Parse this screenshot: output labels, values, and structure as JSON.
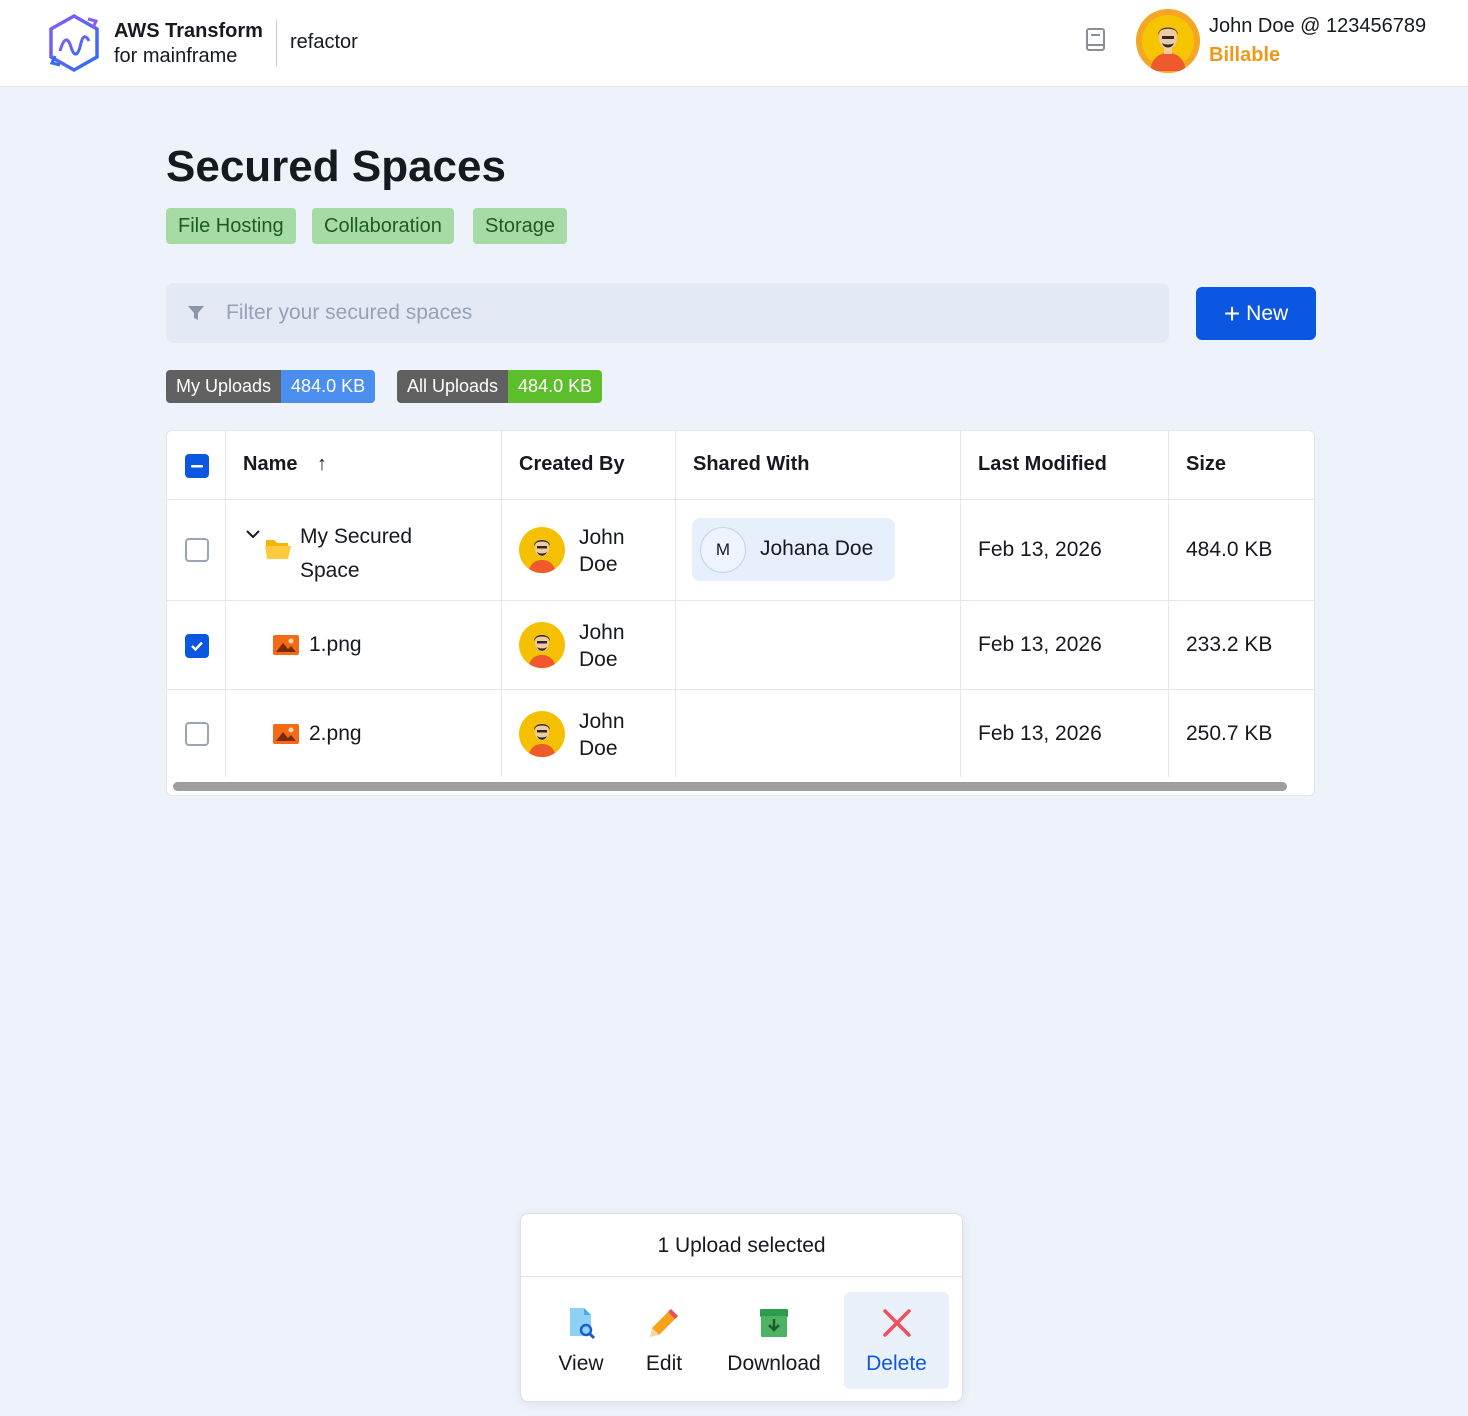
{
  "header": {
    "brand_line1": "AWS Transform",
    "brand_line2": "for mainframe",
    "brand_sub": "refactor",
    "user_name": "John Doe @ 123456789",
    "user_status": "Billable",
    "accent_color": "#ec9a1a"
  },
  "page": {
    "title": "Secured Spaces",
    "tags": [
      "File Hosting",
      "Collaboration",
      "Storage"
    ]
  },
  "filter": {
    "placeholder": "Filter your secured spaces",
    "value": ""
  },
  "toolbar": {
    "new_label": "New"
  },
  "uploads": {
    "my_label": "My Uploads",
    "my_value": "484.0 KB",
    "all_label": "All Uploads",
    "all_value": "484.0 KB"
  },
  "table": {
    "columns": [
      "Name",
      "Created By",
      "Shared With",
      "Last Modified",
      "Size"
    ],
    "sort_indicator": "↑",
    "rows": [
      {
        "selected": false,
        "expanded": true,
        "icon": "folder-icon",
        "name_line1": "My Secured",
        "name_line2": "Space",
        "creator_line1": "John",
        "creator_line2": "Doe",
        "shared_initial": "M",
        "shared_name": "Johana Doe",
        "modified": "Feb 13, 2026",
        "size": "484.0 KB"
      },
      {
        "selected": true,
        "icon": "image-icon",
        "name": "1.png",
        "creator_line1": "John",
        "creator_line2": "Doe",
        "modified": "Feb 13, 2026",
        "size": "233.2 KB"
      },
      {
        "selected": false,
        "icon": "image-icon",
        "name": "2.png",
        "creator_line1": "John",
        "creator_line2": "Doe",
        "modified": "Feb 13, 2026",
        "size": "250.7 KB"
      }
    ]
  },
  "selection": {
    "summary": "1 Upload selected",
    "actions": [
      "View",
      "Edit",
      "Download",
      "Delete"
    ]
  },
  "colors": {
    "primary": "#0b57e1",
    "tag_bg": "#a7dba6",
    "page_bg": "#eef3fb"
  }
}
